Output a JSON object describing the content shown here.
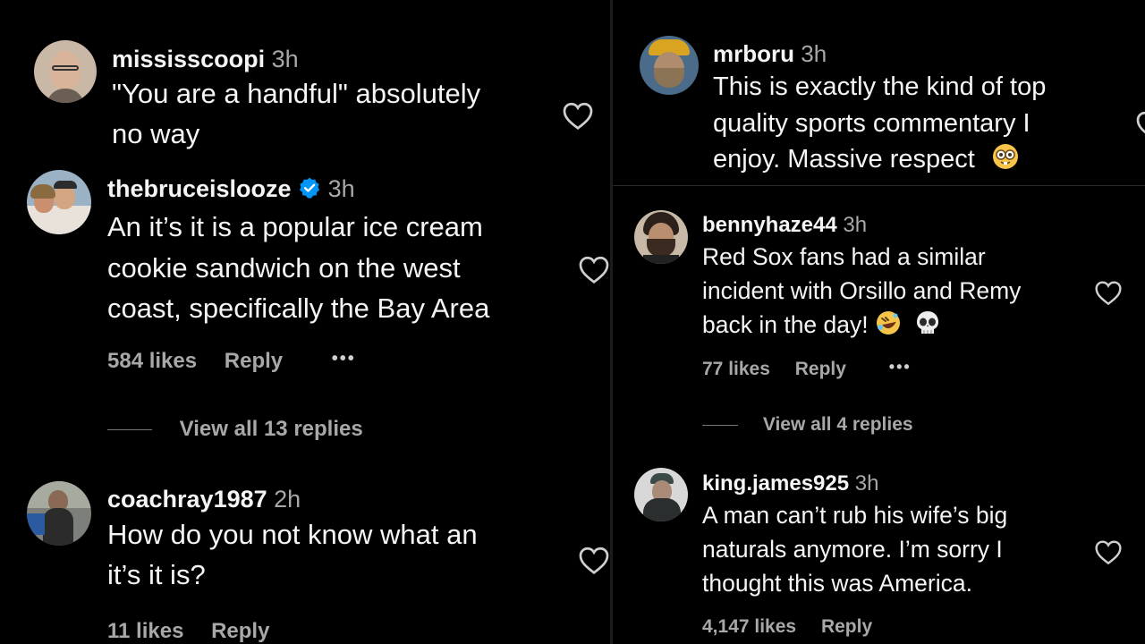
{
  "left": {
    "comments": [
      {
        "username": "mississcoopi",
        "time": "3h",
        "lines": [
          "\"You are a handful\" absolutely",
          "no way"
        ]
      },
      {
        "username": "thebruceislooze",
        "time": "3h",
        "verified": true,
        "lines": [
          "An it’s it is a popular ice cream",
          "cookie sandwich on the west",
          "coast, specifically the Bay Area"
        ],
        "likes": "584 likes",
        "reply": "Reply",
        "more": "•••",
        "view_replies": "View all 13 replies"
      },
      {
        "username": "coachray1987",
        "time": "2h",
        "lines": [
          "How do you not know what an",
          "it’s it is?"
        ],
        "likes": "11 likes",
        "reply": "Reply"
      }
    ]
  },
  "right": {
    "comments": [
      {
        "username": "mrboru",
        "time": "3h",
        "lines": [
          "This is exactly the kind of top",
          "quality sports commentary I",
          "enjoy. Massive respect"
        ],
        "emoji": "nerd-face-emoji"
      },
      {
        "username": "bennyhaze44",
        "time": "3h",
        "lines": [
          "Red Sox fans had a similar",
          "incident with Orsillo and Remy",
          "back in the day!"
        ],
        "emojis": [
          "rolling-on-floor-laughing-emoji",
          "skull-emoji"
        ],
        "likes": "77 likes",
        "reply": "Reply",
        "more": "•••",
        "view_replies": "View all 4 replies"
      },
      {
        "username": "king.james925",
        "time": "3h",
        "lines": [
          "A man can’t rub his wife’s big",
          "naturals anymore. I’m sorry I",
          "thought this was America."
        ],
        "likes": "4,147 likes",
        "reply": "Reply"
      }
    ]
  },
  "colors": {
    "background": "#000000",
    "text": "#f5f5f5",
    "secondary": "#a8a8a8",
    "verified": "#0095f6"
  },
  "icons": [
    "heart-outline-icon",
    "verified-badge-icon",
    "more-options-icon"
  ]
}
